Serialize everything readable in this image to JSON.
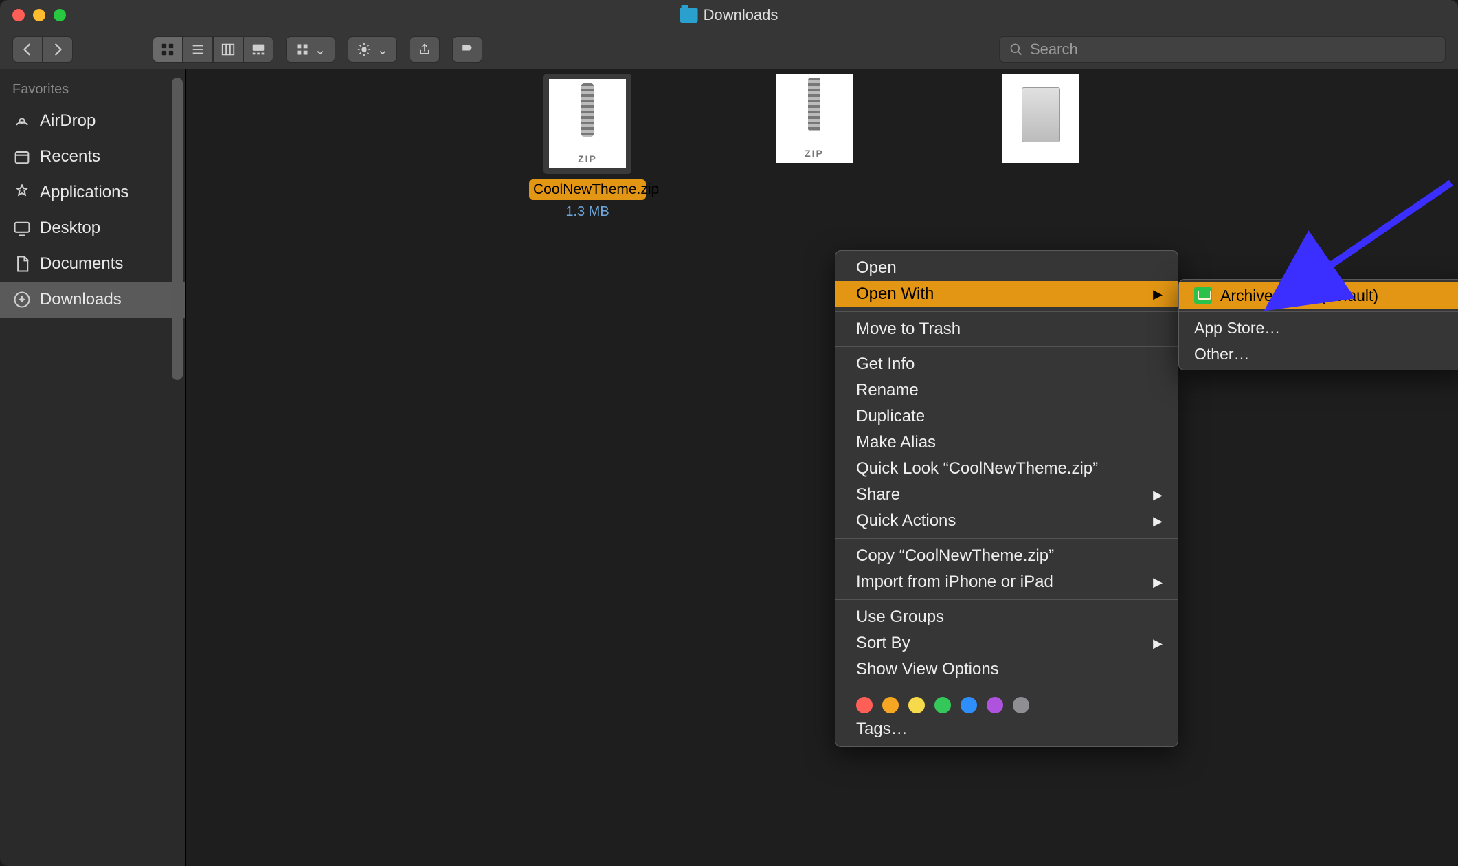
{
  "window": {
    "title": "Downloads"
  },
  "search": {
    "placeholder": "Search"
  },
  "sidebar": {
    "header": "Favorites",
    "items": [
      {
        "label": "AirDrop"
      },
      {
        "label": "Recents"
      },
      {
        "label": "Applications"
      },
      {
        "label": "Desktop"
      },
      {
        "label": "Documents"
      },
      {
        "label": "Downloads"
      }
    ]
  },
  "files": {
    "selected": {
      "name": "CoolNewTheme.zip",
      "size": "1.3 MB",
      "badge": "ZIP"
    },
    "others": [
      {
        "badge": "ZIP"
      },
      {
        "badge": ""
      }
    ]
  },
  "context_menu": {
    "open": "Open",
    "open_with": "Open With",
    "move_to_trash": "Move to Trash",
    "get_info": "Get Info",
    "rename": "Rename",
    "duplicate": "Duplicate",
    "make_alias": "Make Alias",
    "quick_look": "Quick Look “CoolNewTheme.zip”",
    "share": "Share",
    "quick_actions": "Quick Actions",
    "copy": "Copy “CoolNewTheme.zip”",
    "import_iphone": "Import from iPhone or iPad",
    "use_groups": "Use Groups",
    "sort_by": "Sort By",
    "show_view_options": "Show View Options",
    "tags_label": "Tags…",
    "tag_colors": [
      "#ff5f57",
      "#f5a623",
      "#f7d94c",
      "#34c759",
      "#2e8efb",
      "#af52de",
      "#8e8e93"
    ]
  },
  "open_with_menu": {
    "archive_utility": "Archive Utility (default)",
    "app_store": "App Store…",
    "other": "Other…"
  }
}
